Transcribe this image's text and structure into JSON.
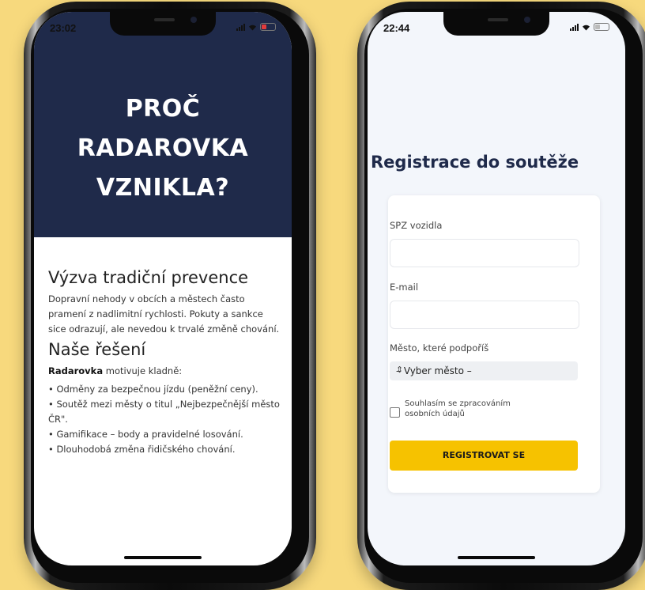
{
  "left_phone": {
    "time": "23:02",
    "hero_title": "PROČ RADAROVKA VZNIKLA?",
    "section1_title": "Výzva tradiční prevence",
    "section1_text": "Dopravní nehody v obcích a městech často pramení z nadlimitní rychlosti. Pokuty a sankce sice odrazují, ale nevedou k trvalé změně chování.",
    "section2_title": "Naše řešení",
    "section2_brand": "Radarovka",
    "section2_intro": " motivuje kladně:",
    "bullets": [
      "Odměny za bezpečnou jízdu (peněžní ceny).",
      "Soutěž mezi městy o titul „Nejbezpečnější město ČR\".",
      "Gamifikace – body a pravidelné losování.",
      "Dlouhodobá změna řidičského chování."
    ]
  },
  "right_phone": {
    "time": "22:44",
    "title": "Registrace do soutěže",
    "spz_label": "SPZ vozidla",
    "spz_value": "",
    "email_label": "E-mail",
    "email_value": "",
    "city_label": "Město, které podpoříš",
    "city_selected": "– Vyber město –",
    "consent_label": "Souhlasím se zpracováním osobních údajů",
    "register_button": "REGISTROVAT SE"
  },
  "colors": {
    "background": "#f7d97d",
    "hero": "#1f2a4a",
    "accent_button": "#f6c200"
  }
}
